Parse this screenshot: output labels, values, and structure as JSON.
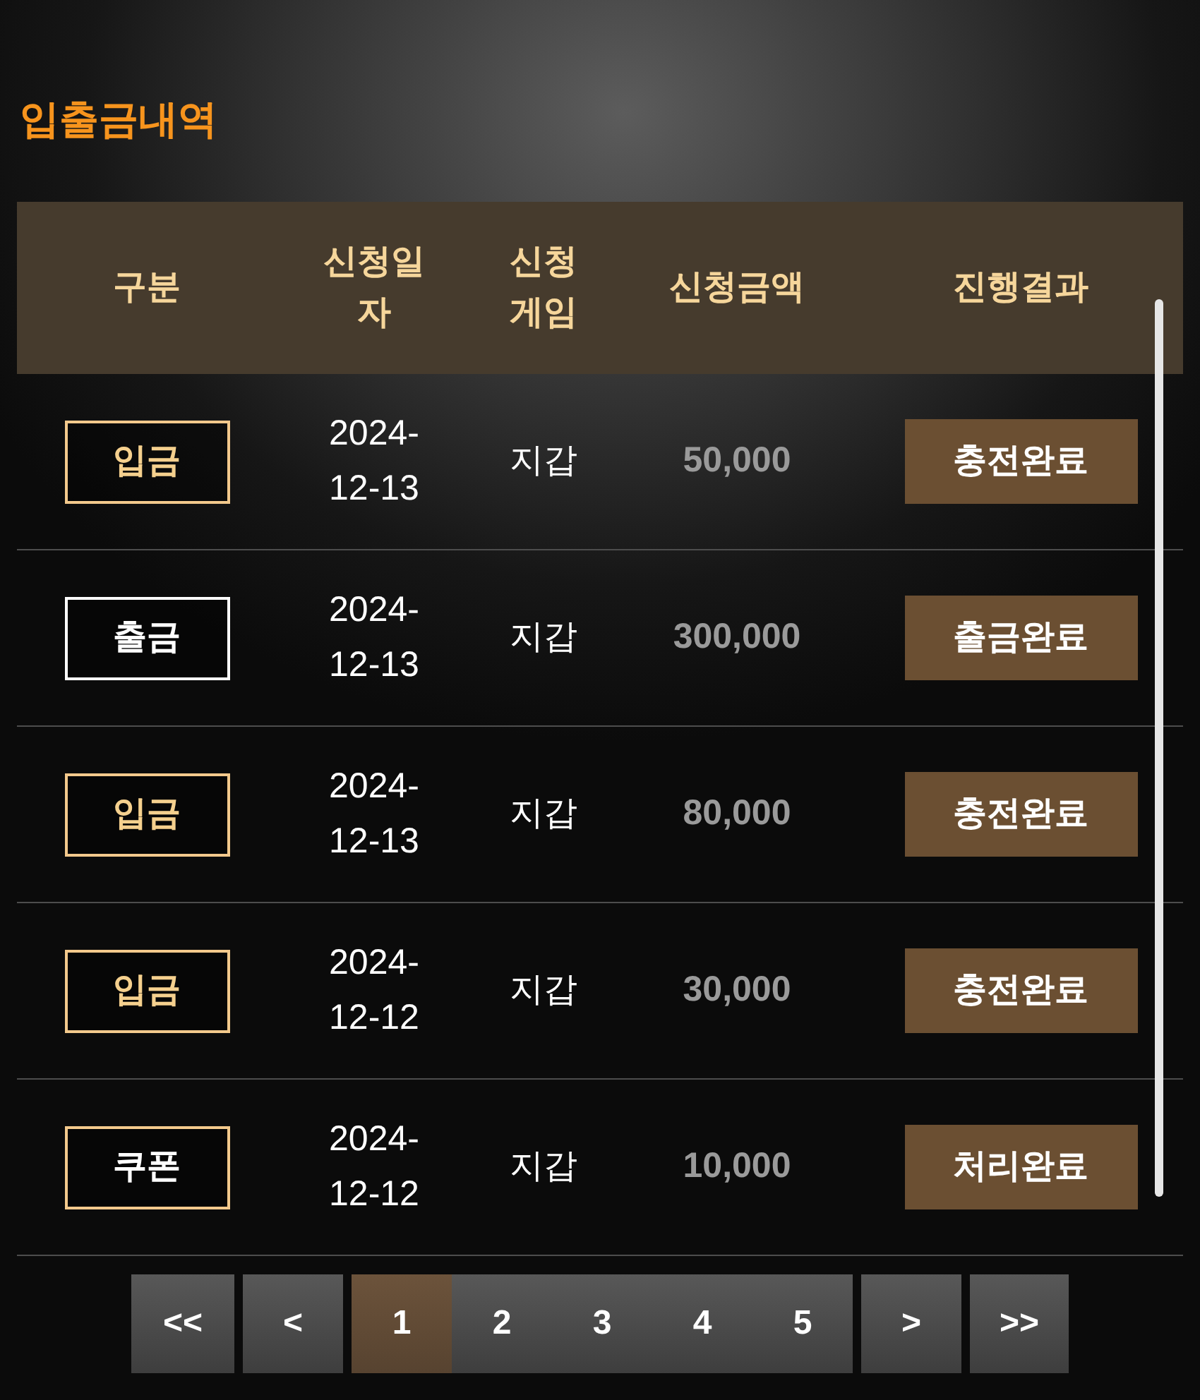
{
  "title": "입출금내역",
  "table": {
    "columns": [
      "구분",
      "신청일자",
      "신청게임",
      "신청금액",
      "진행결과"
    ],
    "rows": [
      {
        "kind": "deposit",
        "type": "입금",
        "date": "2024-12-13",
        "game": "지갑",
        "amount": "50,000",
        "status": "충전완료"
      },
      {
        "kind": "withdrawal",
        "type": "출금",
        "date": "2024-12-13",
        "game": "지갑",
        "amount": "300,000",
        "status": "출금완료"
      },
      {
        "kind": "deposit",
        "type": "입금",
        "date": "2024-12-13",
        "game": "지갑",
        "amount": "80,000",
        "status": "충전완료"
      },
      {
        "kind": "deposit",
        "type": "입금",
        "date": "2024-12-12",
        "game": "지갑",
        "amount": "30,000",
        "status": "충전완료"
      },
      {
        "kind": "coupon",
        "type": "쿠폰",
        "date": "2024-12-12",
        "game": "지갑",
        "amount": "10,000",
        "status": "처리완료"
      }
    ]
  },
  "pagination": {
    "first": "<<",
    "prev": "<",
    "pages": [
      {
        "label": "1",
        "selected": true
      },
      {
        "label": "2",
        "selected": false
      },
      {
        "label": "3",
        "selected": false
      },
      {
        "label": "4",
        "selected": false
      },
      {
        "label": "5",
        "selected": false
      }
    ],
    "next": ">",
    "last": ">>"
  }
}
